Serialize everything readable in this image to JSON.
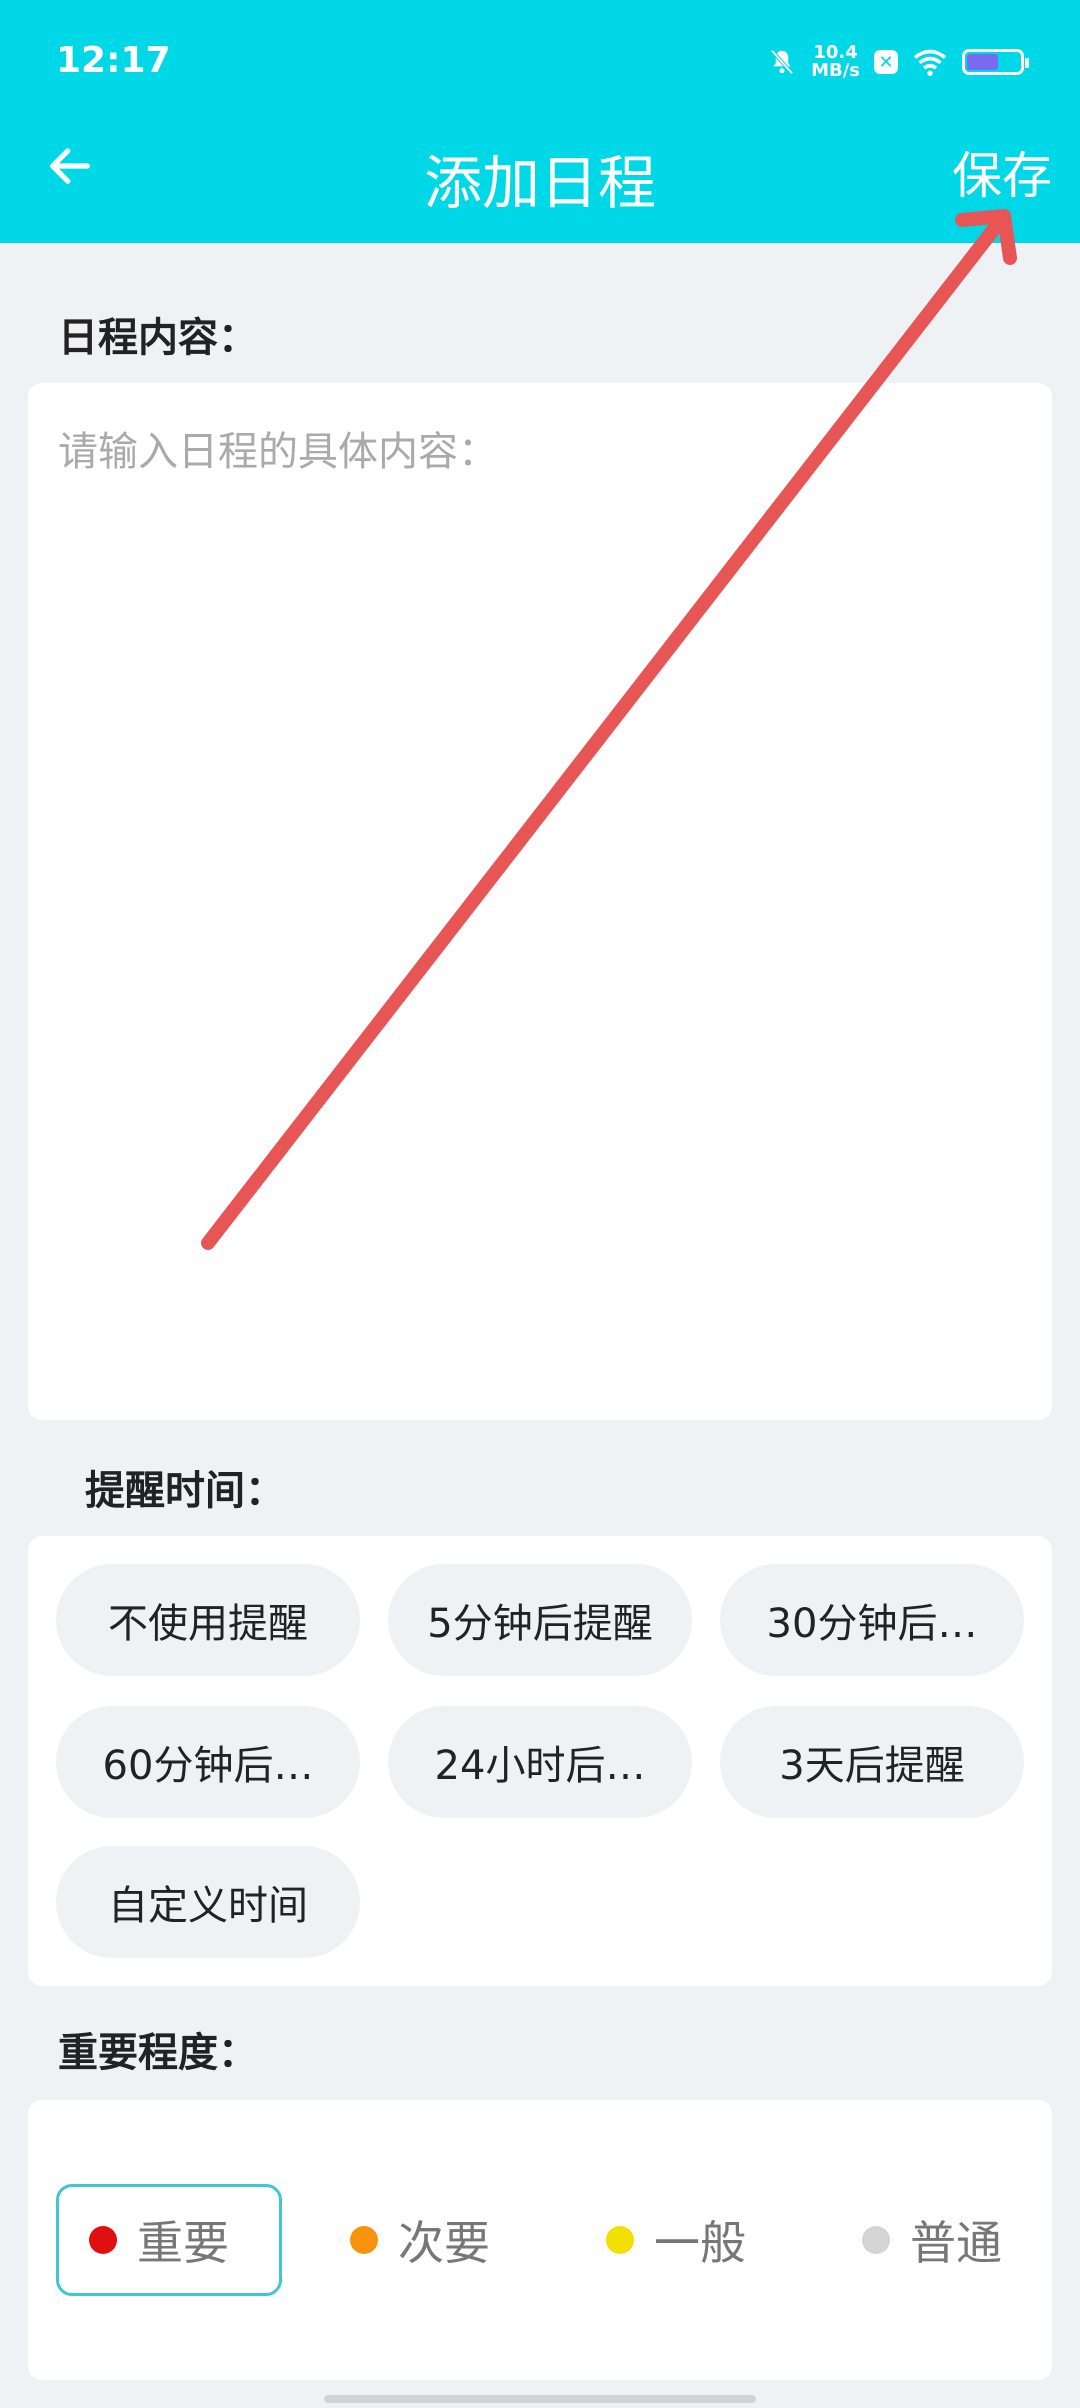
{
  "status_bar": {
    "time": "12:17",
    "net_speed_value": "10.4",
    "net_speed_unit": "MB/s",
    "icons": [
      "bell-muted-icon",
      "x-icon",
      "wifi-icon",
      "battery-icon"
    ]
  },
  "header": {
    "title": "添加日程",
    "save_label": "保存",
    "back_icon": "arrow-left-icon"
  },
  "content": {
    "label": "日程内容：",
    "placeholder": "请输入日程的具体内容："
  },
  "reminder": {
    "label": "提醒时间：",
    "options": [
      "不使用提醒",
      "5分钟后提醒",
      "30分钟后…",
      "60分钟后…",
      "24小时后…",
      "3天后提醒",
      "自定义时间"
    ]
  },
  "importance": {
    "label": "重要程度：",
    "levels": [
      {
        "name": "重要",
        "color": "#e01010",
        "selected": true
      },
      {
        "name": "次要",
        "color": "#f7930d",
        "selected": false
      },
      {
        "name": "一般",
        "color": "#f2e000",
        "selected": false
      },
      {
        "name": "普通",
        "color": "#d4d4d4",
        "selected": false
      }
    ]
  },
  "colors": {
    "accent": "#00d7e7",
    "annotation_arrow": "#e85555"
  }
}
